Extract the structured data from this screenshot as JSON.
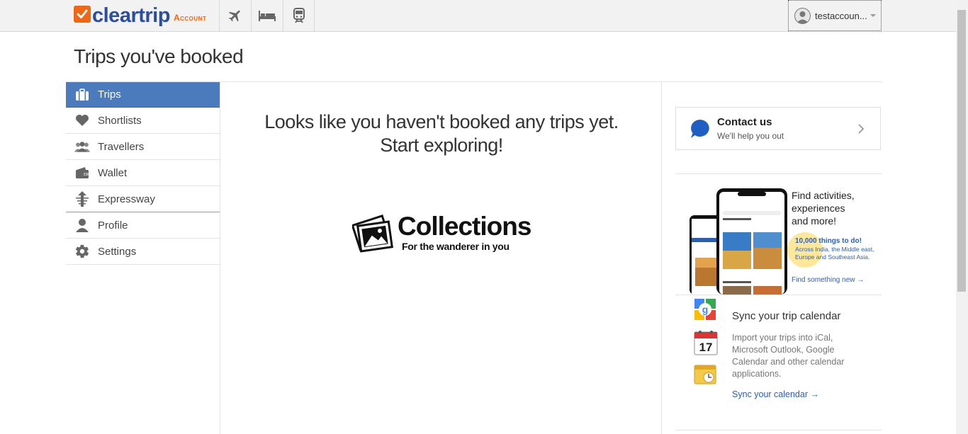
{
  "header": {
    "logo_text": "cleartrip",
    "logo_sub": "Account",
    "nav": [
      {
        "icon": "airplane-icon"
      },
      {
        "icon": "hotel-bed-icon"
      },
      {
        "icon": "train-icon"
      }
    ],
    "user_name": "testaccoun..."
  },
  "page": {
    "title": "Trips you've booked"
  },
  "sidebar": {
    "items": [
      {
        "label": "Trips",
        "icon": "briefcase-icon",
        "active": true
      },
      {
        "label": "Shortlists",
        "icon": "heart-icon"
      },
      {
        "label": "Travellers",
        "icon": "people-icon"
      },
      {
        "label": "Wallet",
        "icon": "wallet-icon"
      },
      {
        "label": "Expressway",
        "icon": "expressway-icon"
      },
      {
        "label": "Profile",
        "icon": "person-icon"
      },
      {
        "label": "Settings",
        "icon": "gear-icon"
      }
    ]
  },
  "main": {
    "empty_line1": "Looks like you haven't booked any trips yet.",
    "empty_line2": "Start exploring!",
    "collections_title": "Collections",
    "collections_sub": "For the wanderer in you"
  },
  "contact": {
    "title": "Contact us",
    "subtitle": "We'll help you out"
  },
  "promo": {
    "heading_line1": "Find activities,",
    "heading_line2": "experiences",
    "heading_line3": "and more!",
    "count": "10,000 things to do!",
    "desc": "Across India, the Middle east, Europe and Southeast Asia.",
    "link": "Find something new →"
  },
  "sync": {
    "title": "Sync your trip calendar",
    "desc": "Import your trips into iCal, Microsoft Outlook, Google Calendar and other calendar applications.",
    "link": "Sync your calendar →",
    "calendar_day": "17"
  },
  "colors": {
    "brand_orange": "#ef6614",
    "brand_blue": "#2c4e9b",
    "active_tab": "#4b7bbd",
    "link": "#2c5fb0"
  }
}
